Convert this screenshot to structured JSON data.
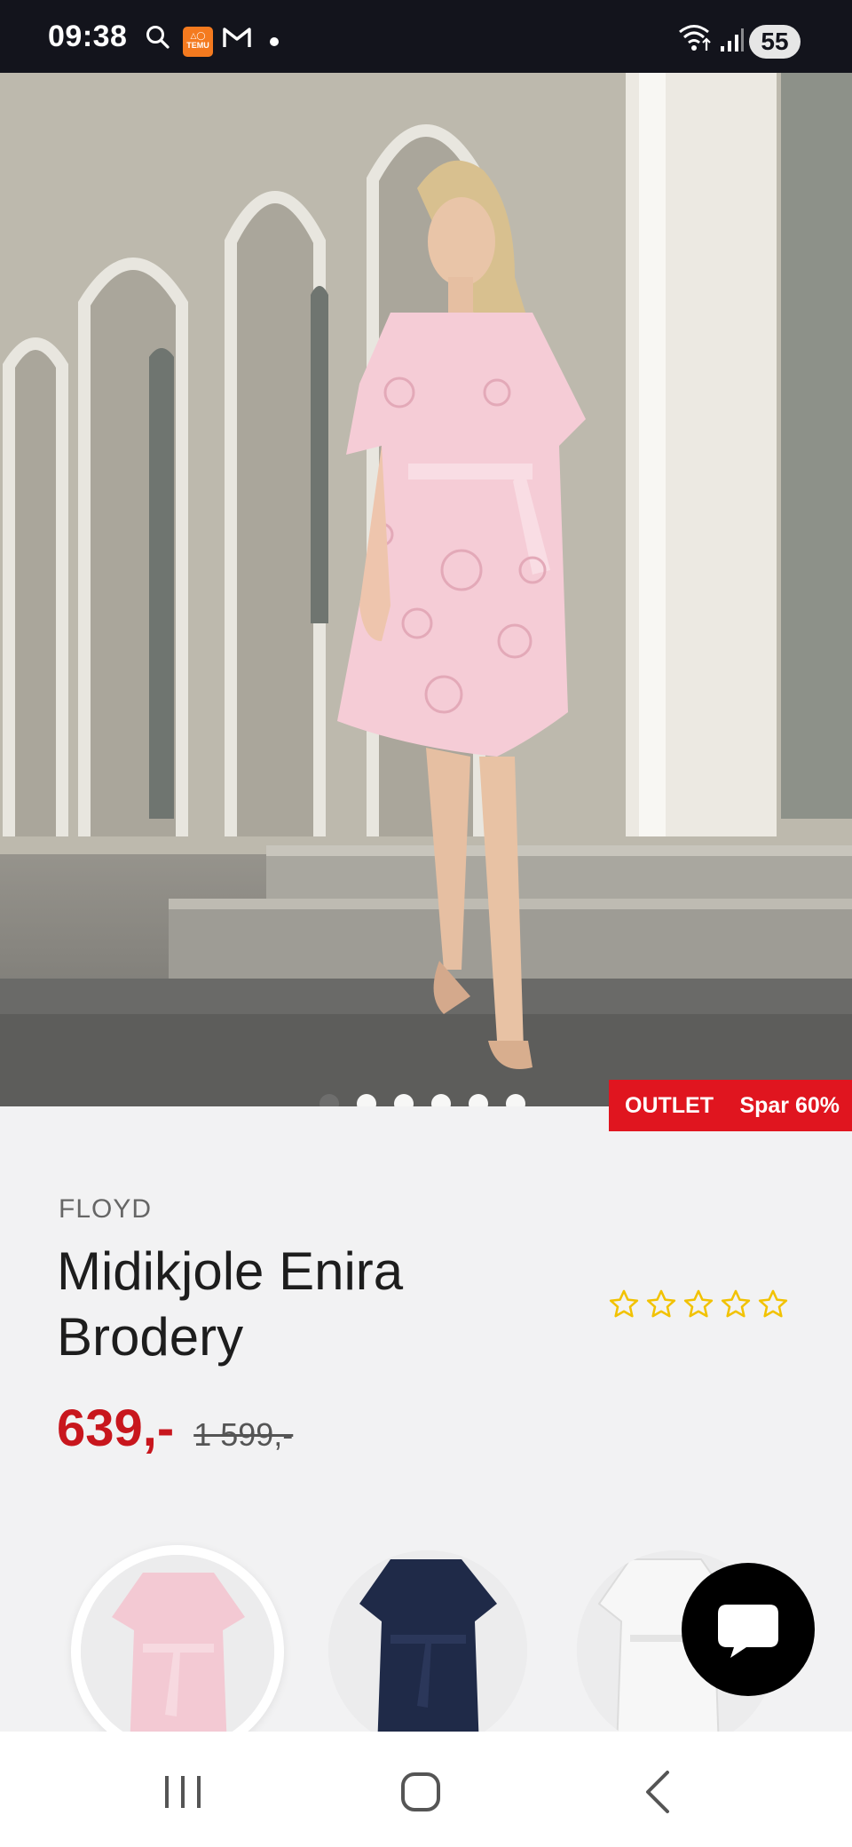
{
  "status_bar": {
    "time": "09:38",
    "battery": "55",
    "icons": [
      "search-icon",
      "temu-app-icon",
      "gmail-icon",
      "notification-dot",
      "wifi-icon",
      "signal-icon",
      "battery-icon"
    ],
    "temu_label": "TEMU"
  },
  "product": {
    "brand": "FLOYD",
    "title": "Midikjole Enira Brodery",
    "price_now": "639,-",
    "price_old": "1 599,-",
    "rating_stars": 0,
    "rating_max": 5,
    "badge_label": "OUTLET",
    "badge_discount": "Spar 60%"
  },
  "gallery": {
    "image_count": 6,
    "active_index": 0
  },
  "variants": [
    {
      "color_name": "pink",
      "color": "#f3c9d3",
      "selected": true
    },
    {
      "color_name": "navy",
      "color": "#1f2a48",
      "selected": false
    },
    {
      "color_name": "white",
      "color": "#f4f4f4",
      "selected": false
    }
  ],
  "colors": {
    "accent_red": "#e0151f",
    "price_red": "#c8161d",
    "star_yellow": "#f2c200"
  }
}
